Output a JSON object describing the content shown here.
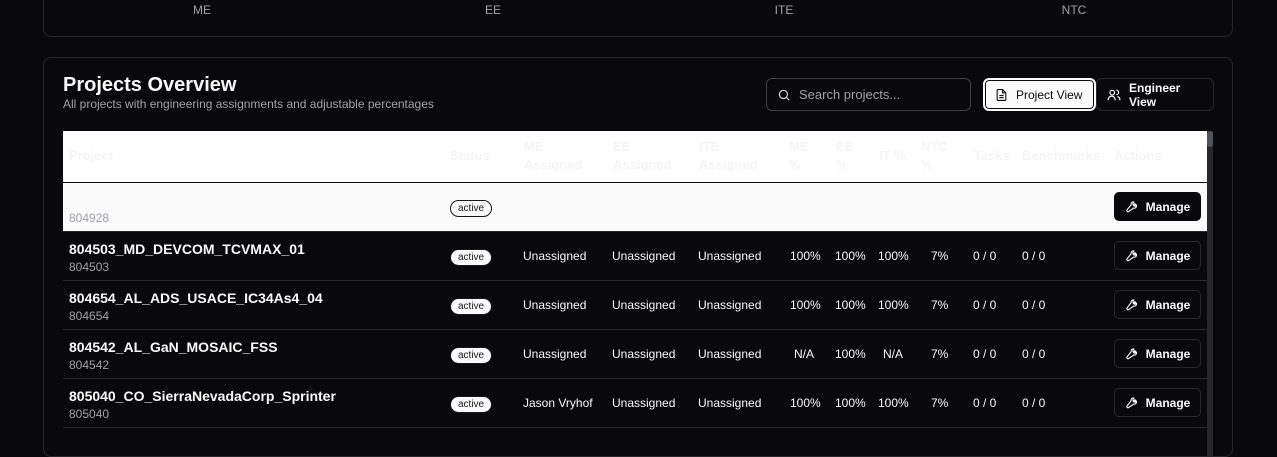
{
  "top_summary": {
    "labels": [
      "ME",
      "EE",
      "ITE",
      "NTC"
    ]
  },
  "header": {
    "title": "Projects Overview",
    "subtitle": "All projects with engineering assignments and adjustable percentages"
  },
  "search": {
    "placeholder": "Search projects...",
    "value": ""
  },
  "view_toggle": {
    "project_view": "Project View",
    "engineer_view": "Engineer View",
    "active": "Project View"
  },
  "table": {
    "columns": {
      "project": "Project",
      "status": "Status",
      "me_assigned": [
        "ME",
        "Assigned"
      ],
      "ee_assigned": [
        "EE",
        "Assigned"
      ],
      "ite_assigned": [
        "ITE",
        "Assigned"
      ],
      "me_pct": [
        "ME",
        "%"
      ],
      "ee_pct": [
        "EE",
        "%"
      ],
      "it_pct": "IT %",
      "ntc_pct": [
        "NTC",
        "%"
      ],
      "tasks": "Tasks",
      "benchmarks": "Benchmarks",
      "actions": "Actions"
    },
    "manage_label": "Manage",
    "rows": [
      {
        "name": "",
        "id": "804928",
        "status": "active",
        "me": "",
        "ee": "",
        "ite": "",
        "me_pct": "",
        "ee_pct": "",
        "it_pct": "",
        "ntc_pct": "",
        "tasks": "",
        "benchmarks": ""
      },
      {
        "name": "804503_MD_DEVCOM_TCVMAX_01",
        "id": "804503",
        "status": "active",
        "me": "Unassigned",
        "ee": "Unassigned",
        "ite": "Unassigned",
        "me_pct": "100%",
        "ee_pct": "100%",
        "it_pct": "100%",
        "ntc_pct": "7%",
        "tasks": "0 / 0",
        "benchmarks": "0 / 0"
      },
      {
        "name": "804654_AL_ADS_USACE_IC34As4_04",
        "id": "804654",
        "status": "active",
        "me": "Unassigned",
        "ee": "Unassigned",
        "ite": "Unassigned",
        "me_pct": "100%",
        "ee_pct": "100%",
        "it_pct": "100%",
        "ntc_pct": "7%",
        "tasks": "0 / 0",
        "benchmarks": "0 / 0"
      },
      {
        "name": "804542_AL_GaN_MOSAIC_FSS",
        "id": "804542",
        "status": "active",
        "me": "Unassigned",
        "ee": "Unassigned",
        "ite": "Unassigned",
        "me_pct": "N/A",
        "ee_pct": "100%",
        "it_pct": "N/A",
        "ntc_pct": "7%",
        "tasks": "0 / 0",
        "benchmarks": "0 / 0"
      },
      {
        "name": "805040_CO_SierraNevadaCorp_Sprinter",
        "id": "805040",
        "status": "active",
        "me": "Jason Vryhof",
        "ee": "Unassigned",
        "ite": "Unassigned",
        "me_pct": "100%",
        "ee_pct": "100%",
        "it_pct": "100%",
        "ntc_pct": "7%",
        "tasks": "0 / 0",
        "benchmarks": "0 / 0"
      }
    ]
  }
}
